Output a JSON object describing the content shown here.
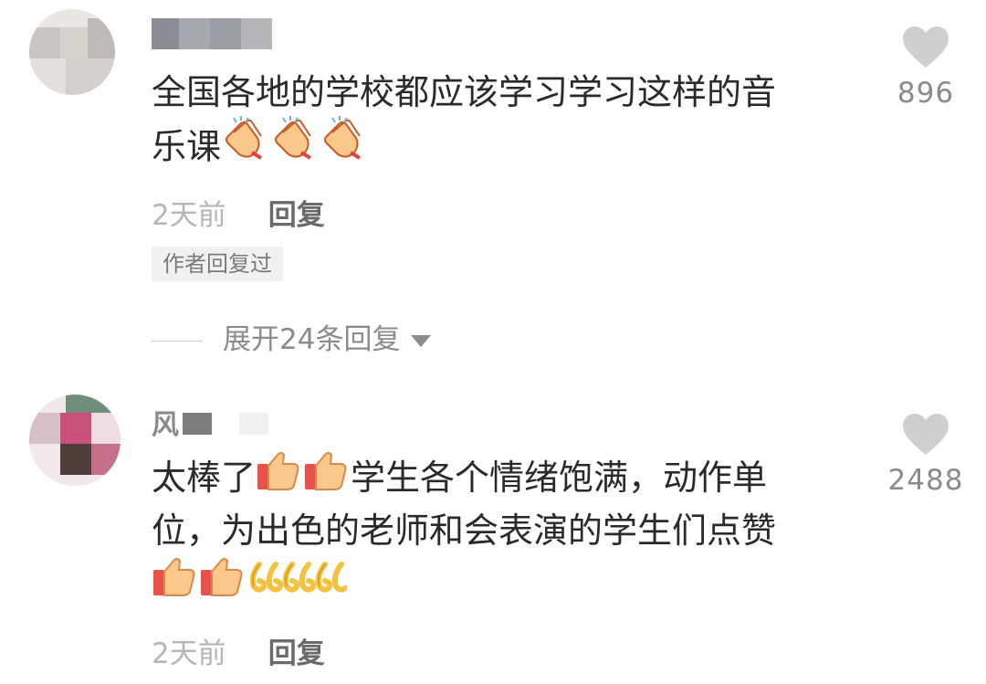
{
  "comments": [
    {
      "username_prefix": "",
      "text_lines": [
        "全国各地的学校都应该学习学习这样的音",
        "乐课"
      ],
      "inline_emoji_line2": [
        "clapping-hands",
        "clapping-hands",
        "clapping-hands"
      ],
      "likes": "896",
      "time": "2天前",
      "reply_label": "回复",
      "author_tag": "作者回复过",
      "expand_label": "展开24条回复"
    },
    {
      "username_prefix": "风",
      "text_line1_start": "太棒了",
      "text_line1_end": "学生各个情绪饱满，动作单",
      "text_line2": "位，为出色的老师和会表演的学生们点赞",
      "inline_emoji_line1": [
        "thumbs-up",
        "thumbs-up"
      ],
      "inline_emoji_line3": [
        "thumbs-up",
        "thumbs-up",
        "666",
        "666"
      ],
      "likes": "2488",
      "time": "2天前",
      "reply_label": "回复"
    }
  ],
  "colors": {
    "text": "#2a2a2a",
    "muted": "#b5b5b5",
    "like_icon": "#cfcfcf",
    "emoji_gold": "#f4c23e",
    "emoji_skin": "#f9c88a"
  }
}
